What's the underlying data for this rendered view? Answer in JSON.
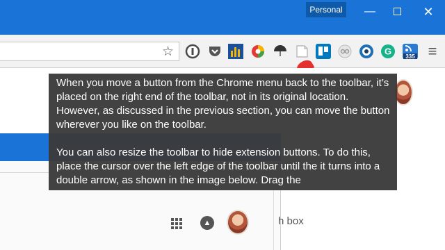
{
  "titlebar": {
    "profile_label": "Personal",
    "minimize_glyph": "—",
    "close_glyph": "✕"
  },
  "toolbar": {
    "star_glyph": "☆",
    "extensions": [
      {
        "name": "info-ext-icon",
        "color": "#4a4a4a"
      },
      {
        "name": "pocket-ext-icon",
        "color": "#555555"
      },
      {
        "name": "chart-ext-icon",
        "color": "#1b4f9c"
      },
      {
        "name": "chromatic-ext-icon",
        "color": "#e8a317"
      },
      {
        "name": "umbrella-ext-icon",
        "color": "#777777"
      },
      {
        "name": "note-ext-icon",
        "color": "#cccccc"
      },
      {
        "name": "trello-ext-icon",
        "color": "#0079bf"
      },
      {
        "name": "glasses-ext-icon",
        "color": "#aaaaaa"
      },
      {
        "name": "eye-ext-icon",
        "color": "#1f8fd6"
      },
      {
        "name": "grammarly-ext-icon",
        "color": "#15b38a"
      },
      {
        "name": "rss-ext-icon",
        "color": "#2a7bd1"
      }
    ],
    "rss_badge": "335",
    "grammarly_letter": "G",
    "menu_glyph": "≡"
  },
  "page": {
    "side_text": "h box",
    "bell_glyph": "🔔"
  },
  "caption": {
    "paragraph_1": "When you move a button from the Chrome menu back to the toolbar, it’s placed on the right end of the toolbar, not in its original location. However, as discussed in the previous section, you can move the button wherever you like on the toolbar.",
    "paragraph_2": "You can also resize the toolbar to hide extension buttons. To do this, place the cursor over the left edge of the toolbar until the it turns into a double arrow, as shown in the image below. Drag the"
  }
}
